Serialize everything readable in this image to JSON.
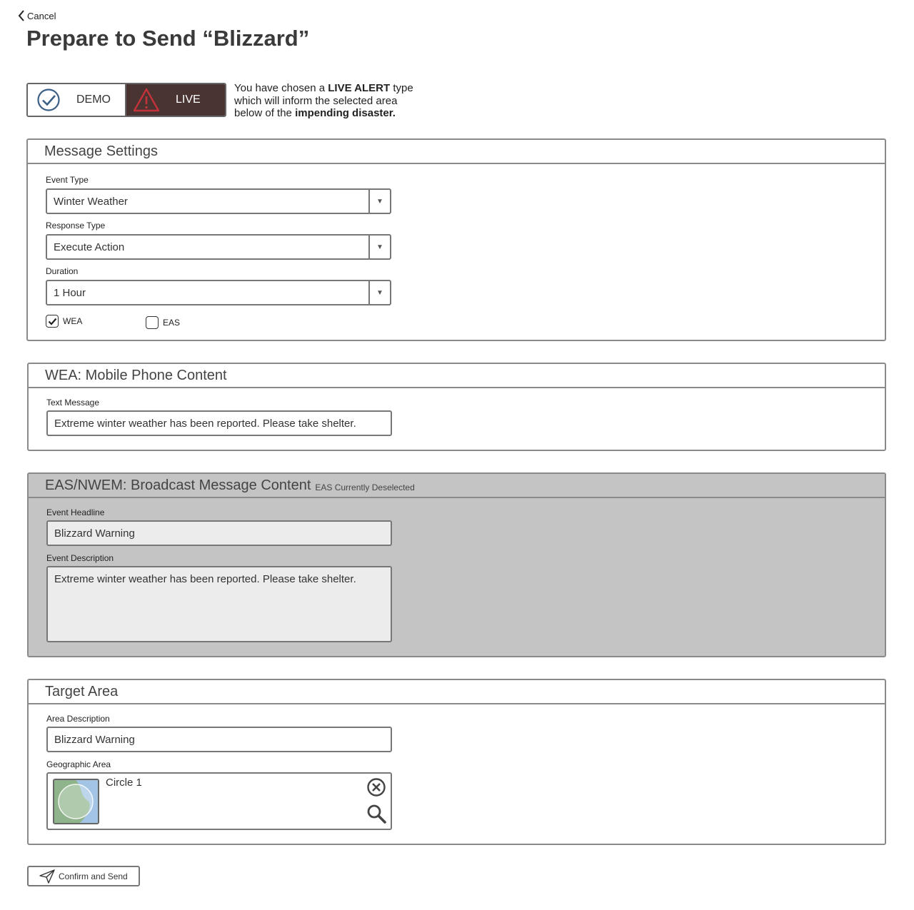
{
  "header": {
    "cancel_label": "Cancel",
    "title": "Prepare to Send “Blizzard”"
  },
  "mode": {
    "demo_label": "DEMO",
    "live_label": "LIVE",
    "selected": "LIVE",
    "description_pre": "You have chosen a ",
    "description_bold1": "LIVE ALERT",
    "description_mid": " type which will inform the selected area below of the ",
    "description_bold2": "impending disaster."
  },
  "message_settings": {
    "title": "Message Settings",
    "event_type": {
      "label": "Event Type",
      "value": "Winter Weather"
    },
    "response_type": {
      "label": "Response Type",
      "value": "Execute Action"
    },
    "duration": {
      "label": "Duration",
      "value": "1 Hour"
    },
    "wea": {
      "label": "WEA",
      "checked": true
    },
    "eas": {
      "label": "EAS",
      "checked": false
    }
  },
  "wea_content": {
    "title": "WEA: Mobile Phone Content",
    "text_message": {
      "label": "Text Message",
      "value": "Extreme winter weather has been reported. Please take shelter."
    }
  },
  "eas_content": {
    "title": "EAS/NWEM: Broadcast Message Content",
    "status": "EAS Currently Deselected",
    "headline": {
      "label": "Event Headline",
      "value": "Blizzard Warning"
    },
    "description": {
      "label": "Event Description",
      "value": "Extreme winter weather has been reported. Please take shelter."
    }
  },
  "target_area": {
    "title": "Target Area",
    "area_description": {
      "label": "Area Description",
      "value": "Blizzard Warning"
    },
    "geographic_area": {
      "label": "Geographic Area",
      "item_name": "Circle 1"
    }
  },
  "actions": {
    "confirm_label": "Confirm and Send"
  },
  "colors": {
    "live_bg": "#4a3432",
    "warning_red": "#c4323a",
    "demo_check_blue": "#3b5f86",
    "disabled_panel": "#c4c4c4"
  }
}
